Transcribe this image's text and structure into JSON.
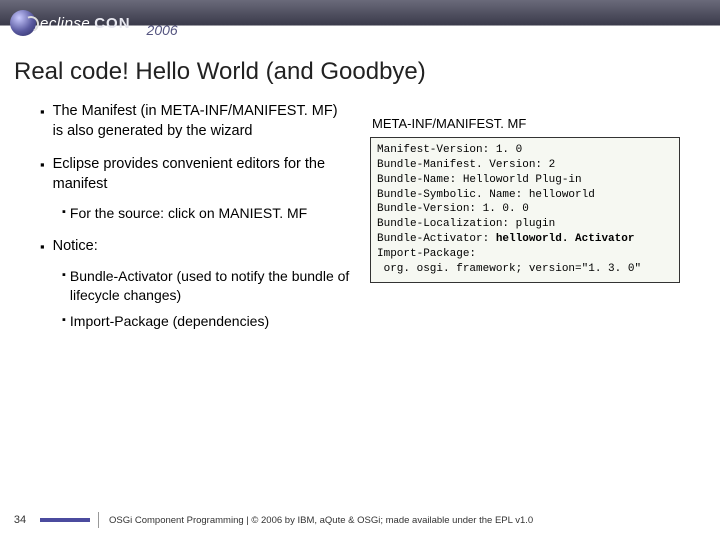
{
  "header": {
    "logo_prefix": "eclipse",
    "logo_suffix": "CON",
    "year": "2006"
  },
  "title": "Real code! Hello World (and Goodbye)",
  "bullets": {
    "b1": "The Manifest (in META-INF/MANIFEST. MF) is also generated by the wizard",
    "b2": "Eclipse provides convenient editors for the manifest",
    "b2_1": "For the source: click on MANIEST. MF",
    "b3": "Notice:",
    "b3_1": "Bundle-Activator (used to notify the bundle of lifecycle changes)",
    "b3_2": "Import-Package (dependencies)"
  },
  "codebox": {
    "label": "META-INF/MANIFEST. MF",
    "lines": {
      "l1": "Manifest-Version: 1. 0",
      "l2": "Bundle-Manifest. Version: 2",
      "l3": "Bundle-Name: Helloworld Plug-in",
      "l4": "Bundle-Symbolic. Name: helloworld",
      "l5": "Bundle-Version: 1. 0. 0",
      "l6": "Bundle-Localization: plugin",
      "l7a": "Bundle-Activator: ",
      "l7b": "helloworld. Activator",
      "l8": "Import-Package:",
      "l9": " org. osgi. framework; version=\"1. 3. 0\""
    }
  },
  "footer": {
    "page": "34",
    "text": "OSGi Component Programming | © 2006 by IBM, aQute & OSGi; made available under the EPL v1.0"
  }
}
